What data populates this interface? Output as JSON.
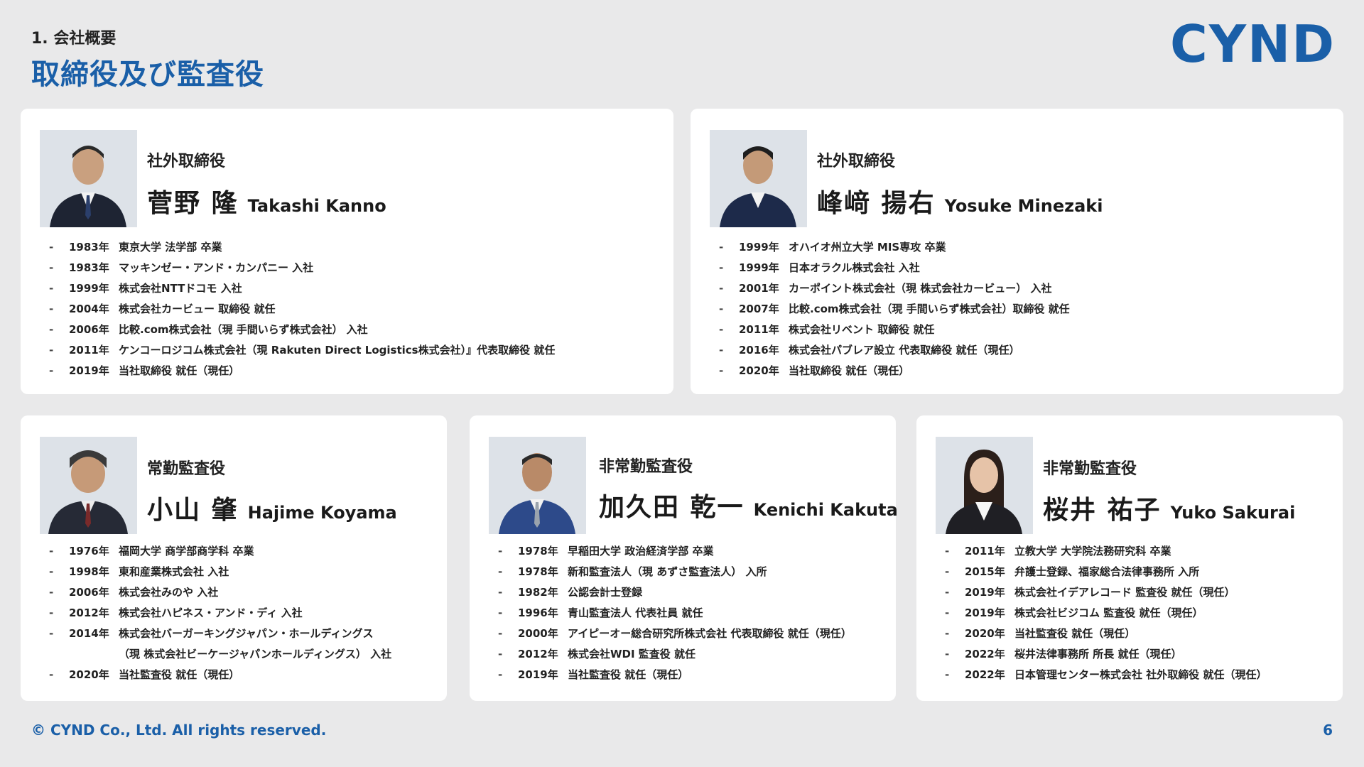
{
  "header": {
    "section": "1. 会社概要",
    "title": "取締役及び監査役",
    "logo": "CYND"
  },
  "directors": [
    {
      "role": "社外取締役",
      "name_jp": "菅野 隆",
      "name_en": "Takashi Kanno",
      "career": [
        {
          "year": "1983年",
          "text": "東京大学 法学部 卒業"
        },
        {
          "year": "1983年",
          "text": "マッキンゼー・アンド・カンパニー 入社"
        },
        {
          "year": "1999年",
          "text": "株式会社NTTドコモ 入社"
        },
        {
          "year": "2004年",
          "text": "株式会社カービュー 取締役 就任"
        },
        {
          "year": "2006年",
          "text": "比較.com株式会社（現 手間いらず株式会社） 入社"
        },
        {
          "year": "2011年",
          "text": "ケンコーロジコム株式会社（現 Rakuten Direct Logistics株式会社）』代表取締役 就任"
        },
        {
          "year": "2019年",
          "text": "当社取締役 就任（現任）"
        }
      ]
    },
    {
      "role": "社外取締役",
      "name_jp": "峰﨑 揚右",
      "name_en": "Yosuke Minezaki",
      "career": [
        {
          "year": "1999年",
          "text": "オハイオ州立大学 MIS専攻 卒業"
        },
        {
          "year": "1999年",
          "text": "日本オラクル株式会社 入社"
        },
        {
          "year": "2001年",
          "text": "カーポイント株式会社（現 株式会社カービュー） 入社"
        },
        {
          "year": "2007年",
          "text": "比較.com株式会社（現 手間いらず株式会社）取締役 就任"
        },
        {
          "year": "2011年",
          "text": "株式会社リベント 取締役 就任"
        },
        {
          "year": "2016年",
          "text": "株式会社パブレア設立 代表取締役 就任（現任）"
        },
        {
          "year": "2020年",
          "text": "当社取締役 就任（現任）"
        }
      ]
    }
  ],
  "auditors": [
    {
      "role": "常勤監査役",
      "name_jp": "小山 肇",
      "name_en": "Hajime Koyama",
      "career": [
        {
          "year": "1976年",
          "text": "福岡大学 商学部商学科 卒業"
        },
        {
          "year": "1998年",
          "text": "東和産業株式会社 入社"
        },
        {
          "year": "2006年",
          "text": "株式会社みのや 入社"
        },
        {
          "year": "2012年",
          "text": "株式会社ハピネス・アンド・ディ 入社"
        },
        {
          "year": "2014年",
          "text": "株式会社バーガーキングジャパン・ホールディングス"
        },
        {
          "year": "",
          "text": "（現 株式会社ビーケージャパンホールディングス） 入社"
        },
        {
          "year": "2020年",
          "text": "当社監査役 就任（現任）"
        }
      ]
    },
    {
      "role": "非常勤監査役",
      "name_jp": "加久田 乾一",
      "name_en": "Kenichi Kakuta",
      "career": [
        {
          "year": "1978年",
          "text": "早稲田大学 政治経済学部 卒業"
        },
        {
          "year": "1978年",
          "text": "新和監査法人（現 あずさ監査法人） 入所"
        },
        {
          "year": "1982年",
          "text": "公認会計士登録"
        },
        {
          "year": "1996年",
          "text": "青山監査法人 代表社員 就任"
        },
        {
          "year": "2000年",
          "text": "アイピーオー総合研究所株式会社 代表取締役 就任（現任）"
        },
        {
          "year": "2012年",
          "text": "株式会社WDI 監査役 就任"
        },
        {
          "year": "2019年",
          "text": "当社監査役 就任（現任）"
        }
      ]
    },
    {
      "role": "非常勤監査役",
      "name_jp": "桜井 祐子",
      "name_en": "Yuko Sakurai",
      "career": [
        {
          "year": "2011年",
          "text": "立教大学 大学院法務研究科 卒業"
        },
        {
          "year": "2015年",
          "text": "弁護士登録、福家総合法律事務所 入所"
        },
        {
          "year": "2019年",
          "text": "株式会社イデアレコード 監査役 就任（現任）"
        },
        {
          "year": "2019年",
          "text": "株式会社ビジコム 監査役 就任（現任）"
        },
        {
          "year": "2020年",
          "text": "当社監査役 就任（現任）"
        },
        {
          "year": "2022年",
          "text": "桜井法律事務所 所長 就任（現任）"
        },
        {
          "year": "2022年",
          "text": "日本管理センター株式会社 社外取締役 就任（現任）"
        }
      ]
    }
  ],
  "footer": {
    "copyright": "© CYND Co., Ltd. All rights reserved.",
    "page": "6"
  },
  "colors": {
    "accent": "#1a5fa8",
    "background": "#e9e9ea",
    "card": "#ffffff"
  },
  "icons": {
    "bullet": "dash"
  }
}
